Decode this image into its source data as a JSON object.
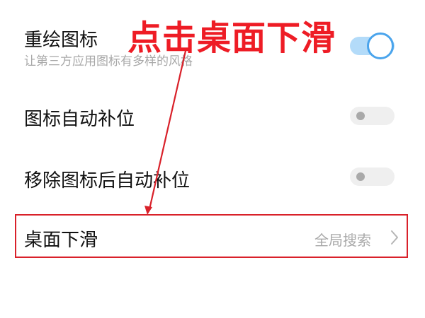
{
  "settings": {
    "redraw_icons": {
      "title": "重绘图标",
      "subtitle": "让第三方应用图标有多样的风格",
      "enabled": true
    },
    "icon_auto_fill": {
      "title": "图标自动补位",
      "enabled": false
    },
    "auto_fill_after_remove": {
      "title": "移除图标后自动补位",
      "enabled": false
    },
    "desktop_swipe_down": {
      "title": "桌面下滑",
      "value": "全局搜索"
    }
  },
  "annotation": {
    "text": "点击桌面下滑",
    "color": "#ee1c25"
  },
  "colors": {
    "toggle_on_track": "#b3dbf9",
    "toggle_on_knob_border": "#4aa4ec",
    "toggle_off_track": "#efefef",
    "highlight_border": "#d9212a"
  },
  "icons": {
    "chevron": "chevron-right-icon"
  }
}
